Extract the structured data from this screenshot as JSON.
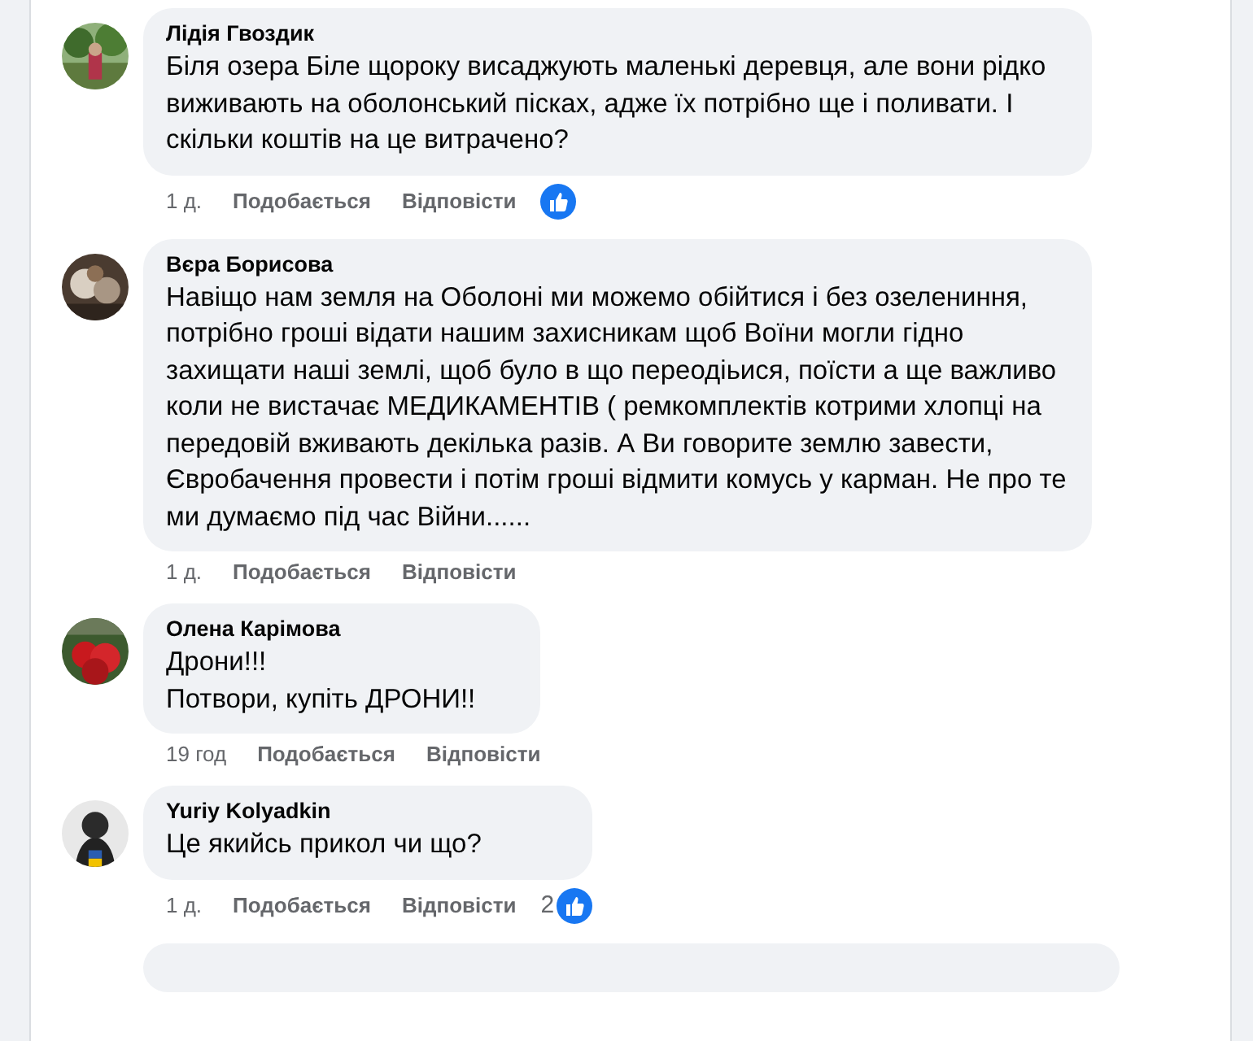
{
  "comments": [
    {
      "author": "Лідія Гвоздик",
      "text": "Біля озера Біле щороку висаджують маленькі деревця, але вони рідко виживають на оболонський пісках, адже їх потрібно ще і поливати. І скільки коштів на це витрачено?",
      "time": "1 д.",
      "like": "Подобається",
      "reply": "Відповісти",
      "reacted": true
    },
    {
      "author": "Вєра Борисова",
      "text": "Навіщо нам земля на Оболоні ми можемо обійтися і без озелениння, потрібно гроші відати нашим захисникам щоб Воїни могли гідно захищати наші землі, щоб було в що переодіьися, поїсти а ще важливо коли не вистачає МЕДИКАМЕНТІВ ( ремкомплектів котрими хлопці на передовій вживають декілька разів. А Ви говорите землю завести, Євробачення провести і потім гроші відмити комусь у карман. Не про те ми думаємо під час Війни......",
      "time": "1 д.",
      "like": "Подобається",
      "reply": "Відповісти",
      "reacted": false
    },
    {
      "author": "Олена Карімова",
      "lines": [
        "Дрони!!!",
        "Потвори, купіть ДРОНИ!!"
      ],
      "time": "19 год",
      "like": "Подобається",
      "reply": "Відповісти",
      "reacted": false
    },
    {
      "author": "Yuriy Kolyadkin",
      "text": "Це якийсь прикол чи що?",
      "time": "1 д.",
      "like": "Подобається",
      "reply": "Відповісти",
      "reacted": true,
      "reaction_count": "2"
    }
  ]
}
